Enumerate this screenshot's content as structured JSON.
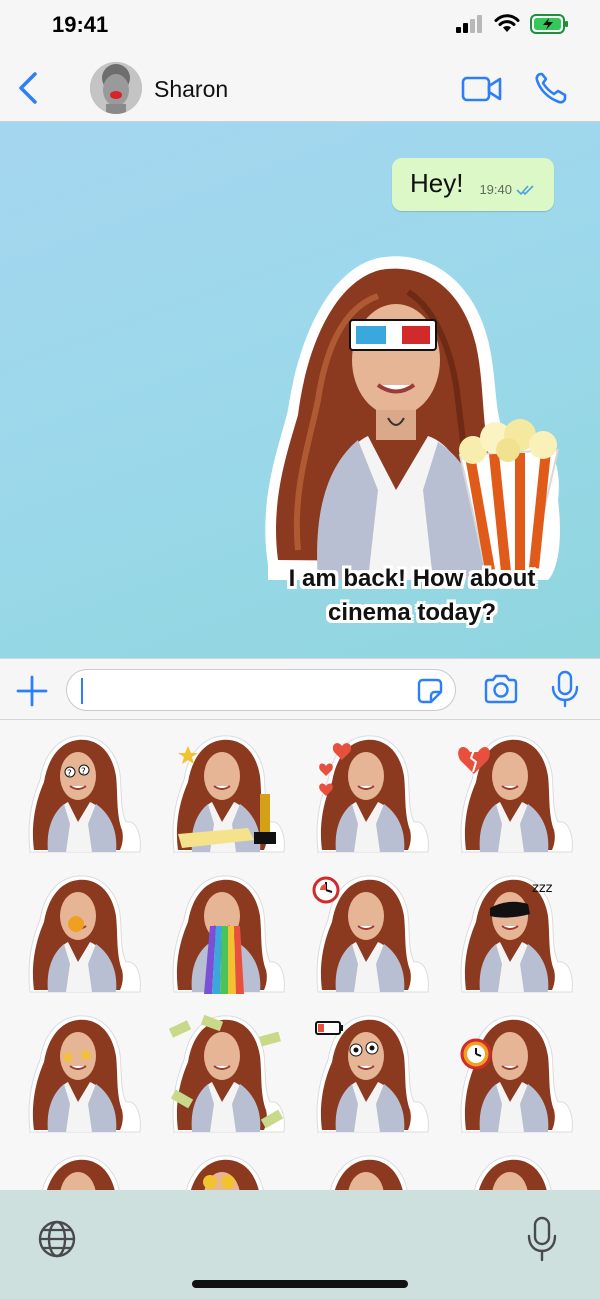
{
  "status_bar": {
    "time": "19:41",
    "icons": [
      "signal-icon",
      "wifi-icon",
      "battery-charging-icon"
    ],
    "battery_color": "#34c759"
  },
  "header": {
    "contact_name": "Sharon",
    "icons": [
      "back-chevron-icon",
      "video-camera-icon",
      "phone-icon"
    ],
    "accent_color": "#2d7ff9"
  },
  "chat": {
    "messages": [
      {
        "text": "Hey!",
        "time": "19:40",
        "status_icon": "double-check-icon"
      }
    ],
    "sticker": {
      "caption_line1": "I am back! How about",
      "caption_line2": "cinema today?"
    }
  },
  "input_bar": {
    "value": "",
    "icons": [
      "plus-icon",
      "sticker-icon",
      "camera-icon",
      "microphone-icon"
    ]
  },
  "sticker_panel": {
    "stickers": [
      "question-eyes",
      "oscar-statue",
      "hearts",
      "broken-heart",
      "surprised-mouth",
      "rainbow-mouth",
      "stopwatch",
      "sleep-mask",
      "star-eyes",
      "money-rain",
      "low-battery",
      "alarm-clock",
      "partial",
      "partial-coin-glasses",
      "partial",
      "partial"
    ]
  },
  "keyboard": {
    "icons": [
      "globe-icon",
      "dictation-microphone-icon"
    ]
  }
}
